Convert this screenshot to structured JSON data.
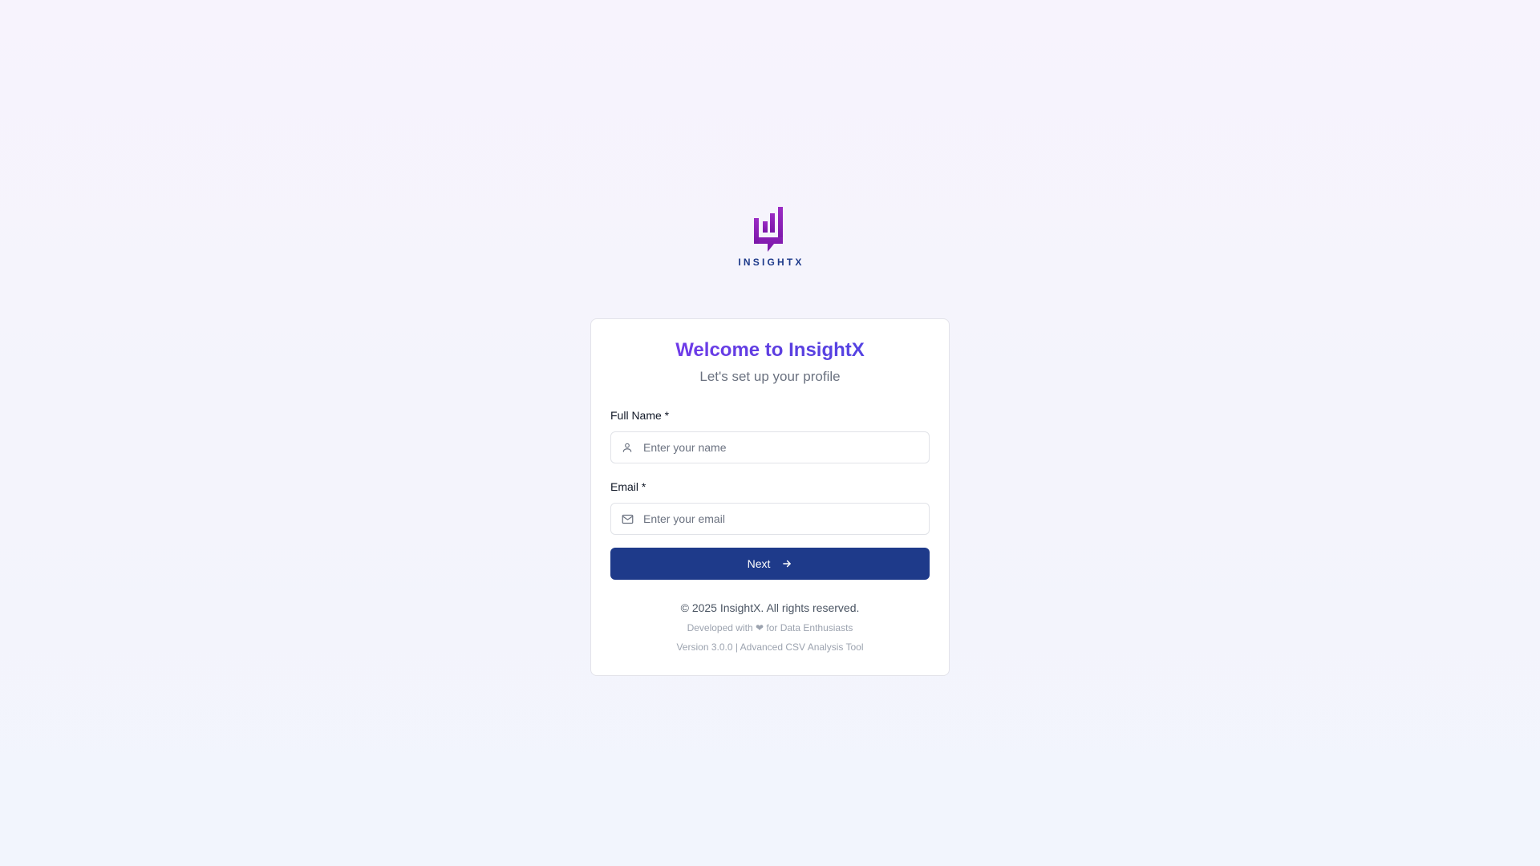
{
  "brand": {
    "logo_text": "INSIGHTX",
    "logo_icon": "bar-chart-speech-bubble-icon",
    "colors": {
      "logo_purple": "#8b1fb8",
      "logo_text": "#1d3a8a"
    }
  },
  "card": {
    "title": "Welcome to InsightX",
    "subtitle": "Let's set up your profile"
  },
  "form": {
    "name_label": "Full Name *",
    "name_placeholder": "Enter your name",
    "name_value": "",
    "name_icon": "user-icon",
    "email_label": "Email *",
    "email_placeholder": "Enter your email",
    "email_value": "",
    "email_icon": "mail-icon",
    "next_label": "Next",
    "next_icon": "arrow-right-icon"
  },
  "footer": {
    "copyright": "© 2025 InsightX. All rights reserved.",
    "dev_prefix": "Developed with",
    "dev_heart": "❤",
    "dev_suffix": "for Data Enthusiasts",
    "version": "Version 3.0.0 | Advanced CSV Analysis Tool"
  },
  "colors": {
    "primary_button": "#1e3a8a",
    "title_gradient_start": "#7c3aed",
    "title_gradient_end": "#4f46e5"
  }
}
